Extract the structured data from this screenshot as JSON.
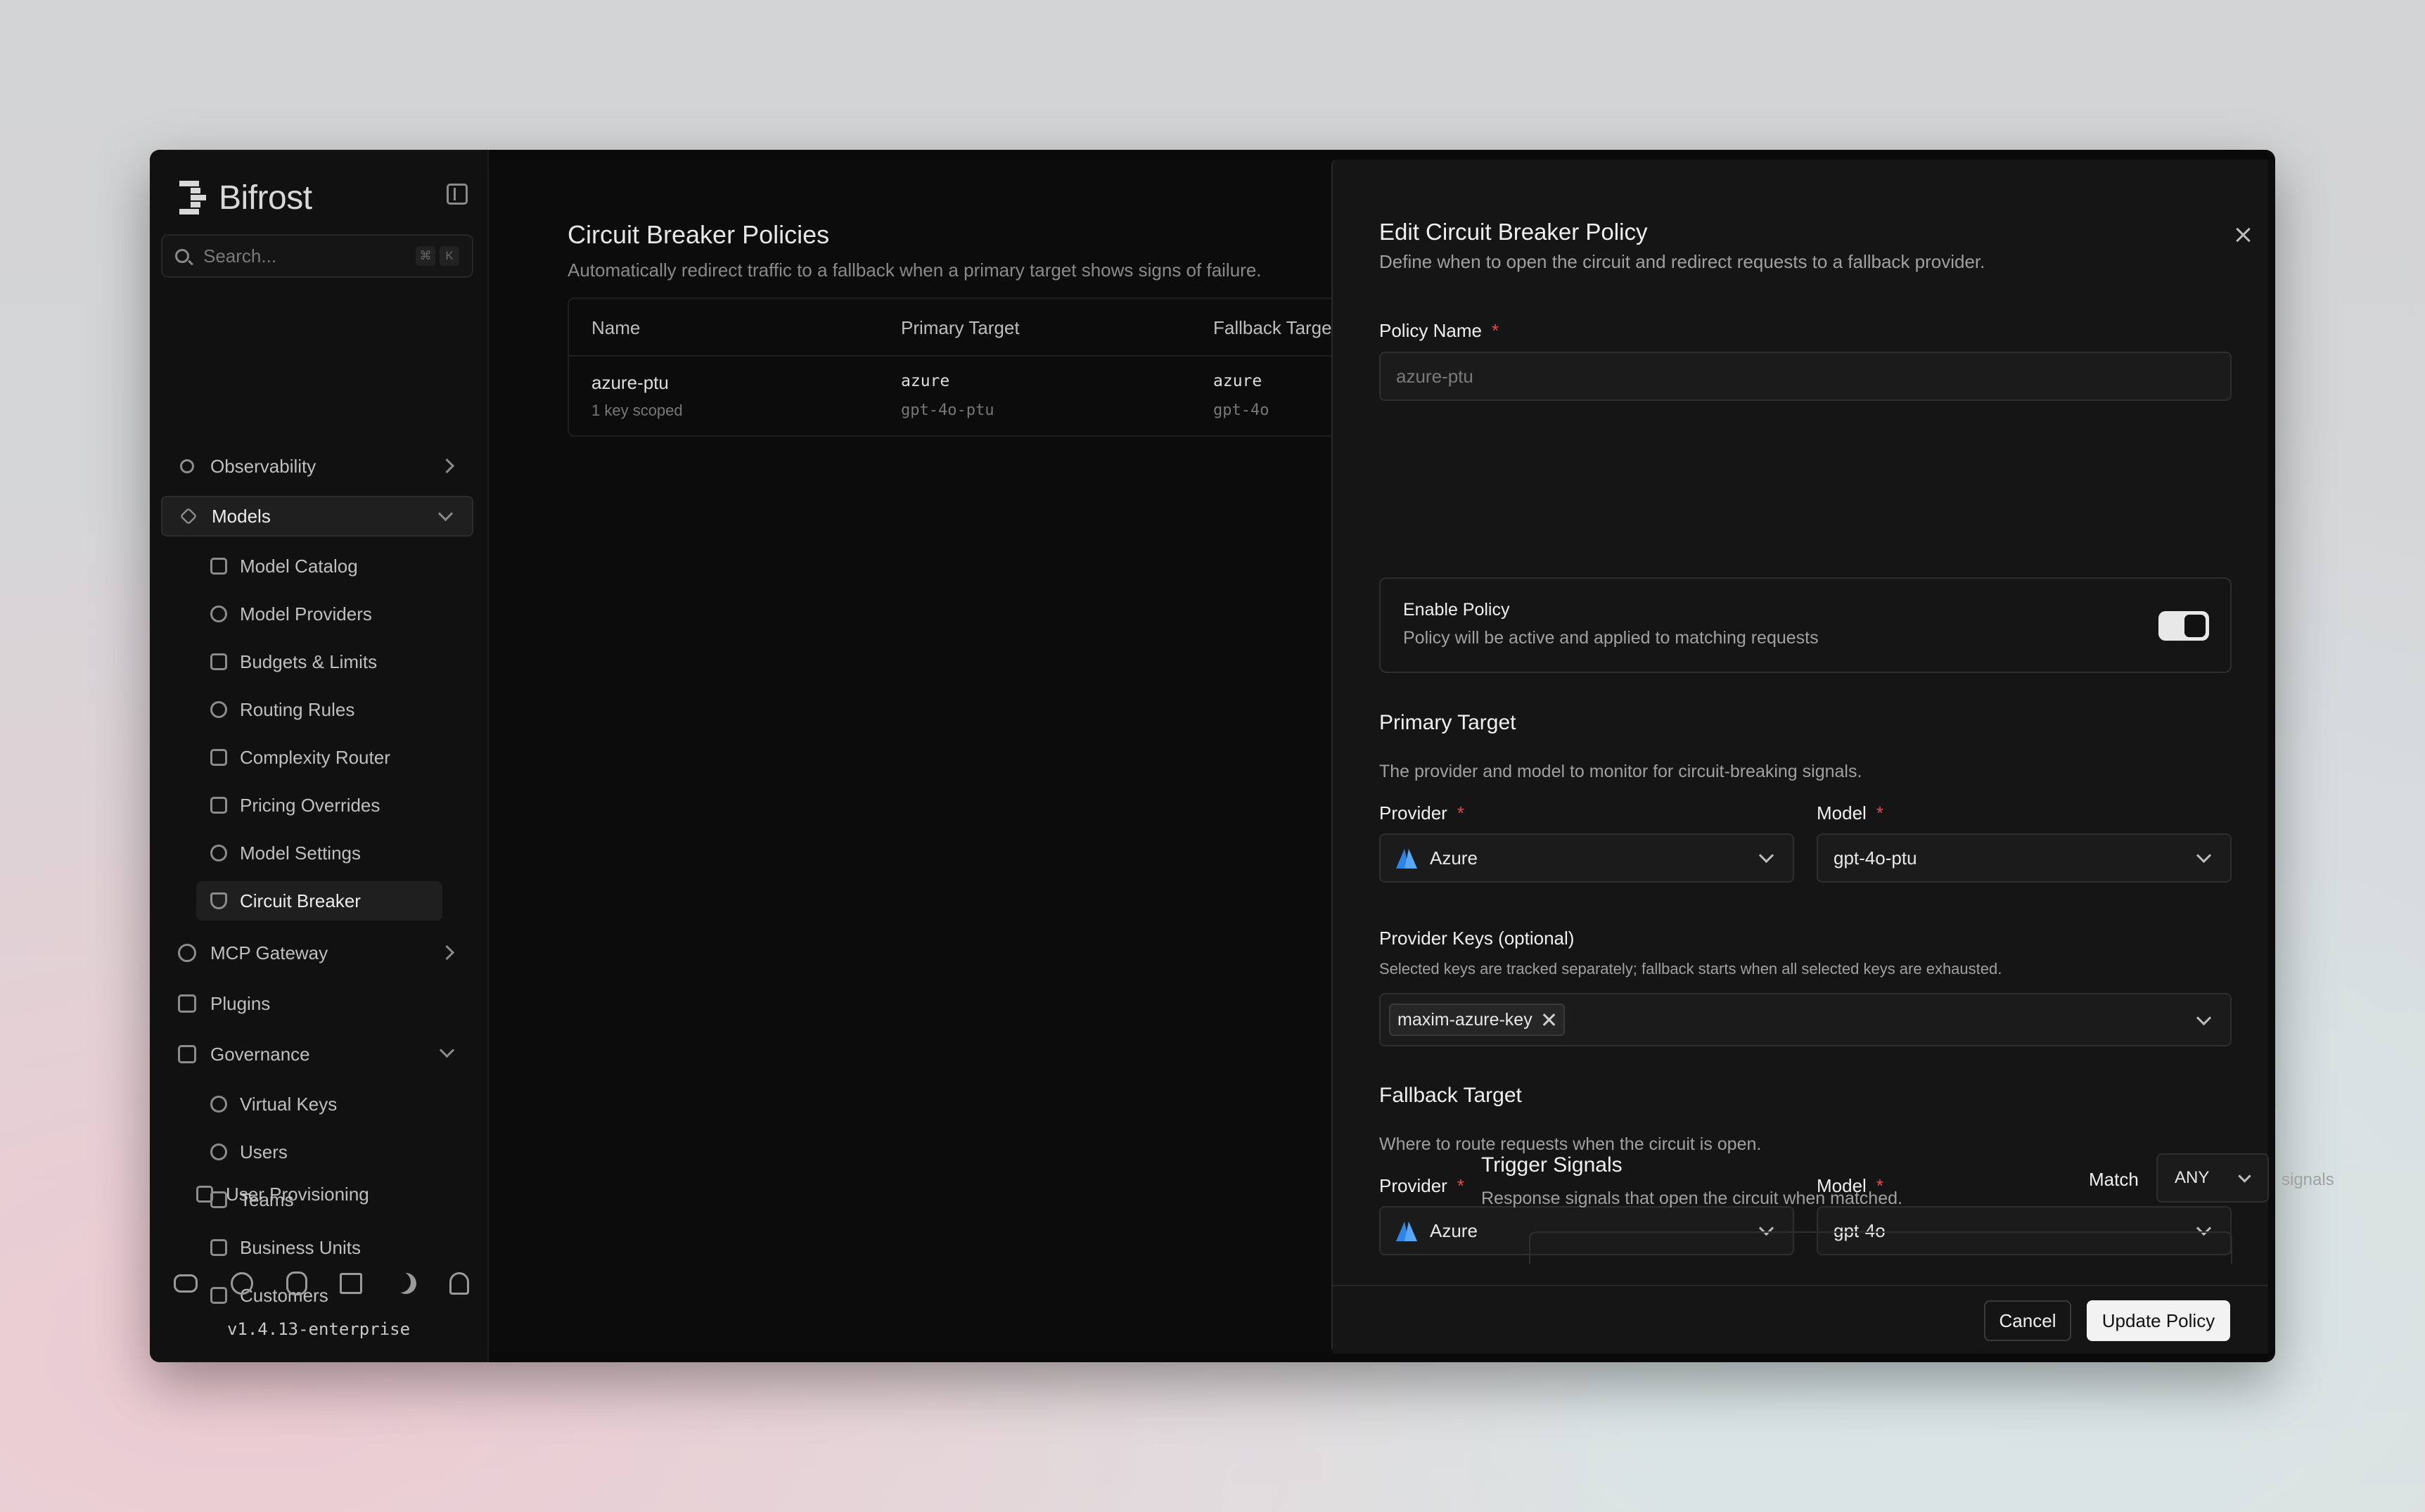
{
  "app": {
    "name": "Bifrost",
    "version": "v1.4.13-enterprise"
  },
  "search": {
    "placeholder": "Search...",
    "kbd": [
      "⌘",
      "K"
    ]
  },
  "sidebar": {
    "observability": "Observability",
    "models": "Models",
    "models_children": [
      "Model Catalog",
      "Model Providers",
      "Budgets & Limits",
      "Routing Rules",
      "Complexity Router",
      "Pricing Overrides",
      "Model Settings",
      "Circuit Breaker"
    ],
    "mcp_gateway": "MCP Gateway",
    "plugins": "Plugins",
    "governance": "Governance",
    "governance_children": [
      "Virtual Keys",
      "Users",
      "Teams",
      "Business Units",
      "Customers",
      "User Provisioning"
    ]
  },
  "page": {
    "title": "Circuit Breaker Policies",
    "subtitle": "Automatically redirect traffic to a fallback when a primary target shows signs of failure.",
    "table": {
      "headers": [
        "Name",
        "Primary Target",
        "Fallback Targe"
      ],
      "rows": [
        {
          "name": "azure-ptu",
          "scope": "1 key scoped",
          "primary_provider": "azure",
          "primary_model": "gpt-4o-ptu",
          "fallback_provider": "azure",
          "fallback_model": "gpt-4o"
        }
      ]
    }
  },
  "dialog": {
    "title": "Edit Circuit Breaker Policy",
    "subtitle": "Define when to open the circuit and redirect requests to a fallback provider.",
    "policy_name_label": "Policy Name",
    "policy_name_placeholder": "azure-ptu",
    "enable_title": "Enable Policy",
    "enable_desc": "Policy will be active and applied to matching requests",
    "enabled": true,
    "primary": {
      "heading": "Primary Target",
      "desc": "The provider and model to monitor for circuit-breaking signals.",
      "provider_label": "Provider",
      "provider_value": "Azure",
      "model_label": "Model",
      "model_value": "gpt-4o-ptu"
    },
    "provider_keys": {
      "label": "Provider Keys (optional)",
      "desc": "Selected keys are tracked separately; fallback starts when all selected keys are exhausted.",
      "chip": "maxim-azure-key"
    },
    "fallback": {
      "heading": "Fallback Target",
      "desc": "Where to route requests when the circuit is open.",
      "provider_label": "Provider",
      "provider_value": "Azure",
      "model_label": "Model",
      "model_value": "gpt-4o"
    },
    "triggers": {
      "heading": "Trigger Signals",
      "desc": "Response signals that open the circuit when matched.",
      "match_label": "Match",
      "match_value": "ANY",
      "signals_label": "signals"
    },
    "cancel": "Cancel",
    "submit": "Update Policy"
  },
  "colors": {
    "accent": "#f2f2f2",
    "required": "#e5484d",
    "azure": "#2d86e6"
  }
}
